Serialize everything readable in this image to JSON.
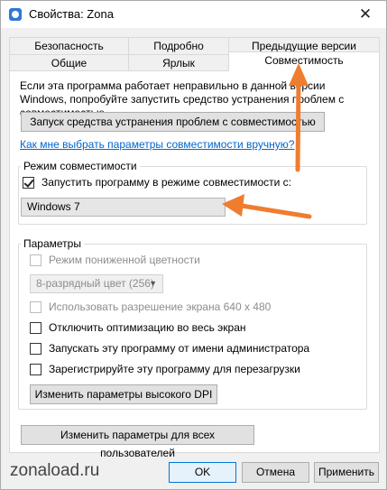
{
  "window": {
    "title": "Свойства: Zona",
    "close_glyph": "✕"
  },
  "tabs": {
    "row_back": [
      "Безопасность",
      "Подробно",
      "Предыдущие версии"
    ],
    "row_front": [
      "Общие",
      "Ярлык",
      "Совместимость"
    ],
    "active": "Совместимость"
  },
  "intro": {
    "text": "Если эта программа работает неправильно в данной версии Windows, попробуйте запустить средство устранения проблем с совместимостью.",
    "troubleshooter_button": "Запуск средства устранения проблем с совместимостью",
    "help_link": "Как мне выбрать параметры совместимости вручную?"
  },
  "compat_mode": {
    "group_label": "Режим совместимости",
    "checkbox_label": "Запустить программу в режиме совместимости с:",
    "checked": true,
    "selected_os": "Windows 7"
  },
  "settings": {
    "group_label": "Параметры",
    "reduced_color": {
      "label": "Режим пониженной цветности",
      "checked": false,
      "enabled": false
    },
    "color_depth": {
      "value": "8-разрядный цвет (256)",
      "enabled": false
    },
    "res_640": {
      "label": "Использовать разрешение экрана 640 x 480",
      "checked": false,
      "enabled": false
    },
    "disable_fullscreen": {
      "label": "Отключить оптимизацию во весь экран",
      "checked": false
    },
    "run_as_admin": {
      "label": "Запускать эту программу от имени администратора",
      "checked": false
    },
    "register_restart": {
      "label": "Зарегистрируйте эту программу для перезагрузки",
      "checked": false
    },
    "dpi_button": "Изменить параметры высокого DPI"
  },
  "all_users_button": "Изменить параметры для всех пользователей",
  "footer": {
    "watermark": "zonaload.ru",
    "ok": "OK",
    "cancel": "Отмена",
    "apply": "Применить"
  },
  "colors": {
    "annotation_arrow": "#ef7d2f",
    "link": "#0066cc",
    "focus": "#0078d7"
  }
}
